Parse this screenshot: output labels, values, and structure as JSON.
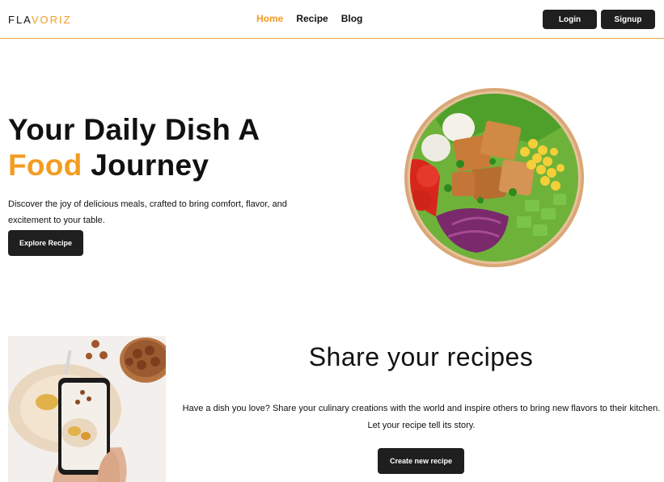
{
  "header": {
    "logo_prefix": "FLA",
    "logo_accent": "VORIZ",
    "nav": [
      {
        "label": "Home",
        "active": true
      },
      {
        "label": "Recipe",
        "active": false
      },
      {
        "label": "Blog",
        "active": false
      }
    ],
    "login_label": "Login",
    "signup_label": "Signup"
  },
  "hero": {
    "title_line1": "Your Daily Dish A",
    "title_accent": "Food",
    "title_rest": " Journey",
    "description": "Discover the joy of delicious meals, crafted to bring comfort, flavor, and excitement to your table.",
    "cta_label": "Explore Recipe"
  },
  "share": {
    "title": "Share your recipes",
    "description_line1": "Have a dish you love? Share your culinary creations with the world and inspire others to bring new flavors to their kitchen.",
    "description_line2": "Let your recipe tell its story.",
    "cta_label": "Create new recipe"
  },
  "colors": {
    "accent": "#f39c21",
    "button_dark": "#1f1f1f",
    "header_border": "#f0a53a"
  }
}
